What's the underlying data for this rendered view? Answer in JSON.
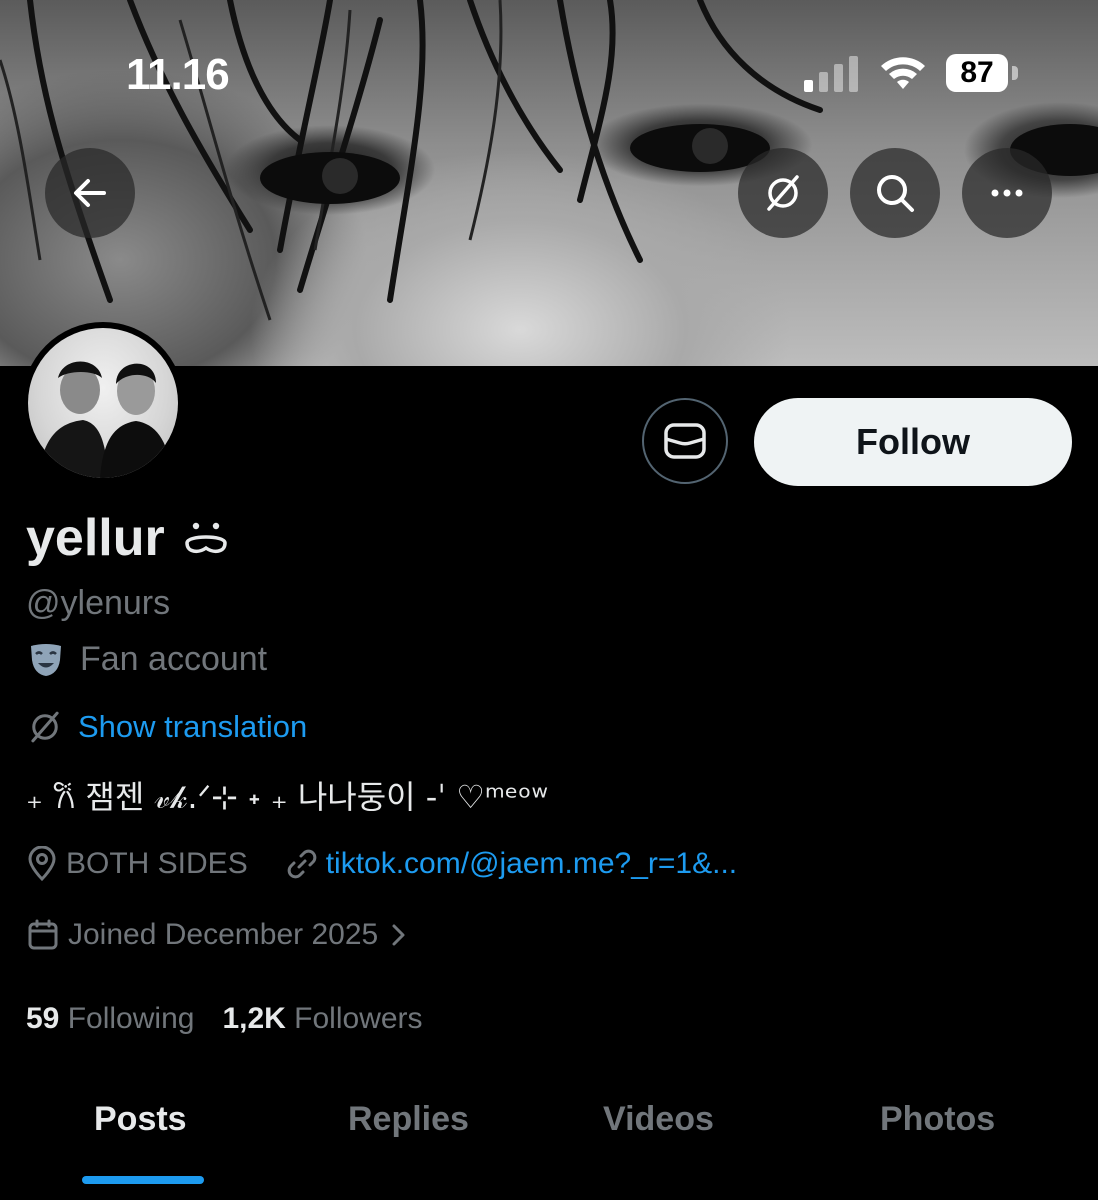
{
  "status_bar": {
    "time": "11.16",
    "battery": "87"
  },
  "profile": {
    "display_name": "yellur",
    "handle": "@ylenurs",
    "category": "Fan account",
    "translate_label": "Show translation",
    "bio": "₊ 𐙚 잼젠 𝓋𝓀.ᐟ⊹ ˖ ₊ 나나둥이 -ˈ ♡ᵐᵉᵒʷ",
    "location": "BOTH SIDES",
    "website": "tiktok.com/@jaem.me?_r=1&...",
    "joined": "Joined December 2025",
    "following_count": "59",
    "following_label": "Following",
    "followers_count": "1,2K",
    "followers_label": "Followers"
  },
  "actions": {
    "follow_label": "Follow"
  },
  "tabs": [
    "Posts",
    "Replies",
    "Videos",
    "Photos"
  ],
  "colors": {
    "accent": "#1d9bf0",
    "muted": "#71767b",
    "text": "#e7e9ea"
  }
}
